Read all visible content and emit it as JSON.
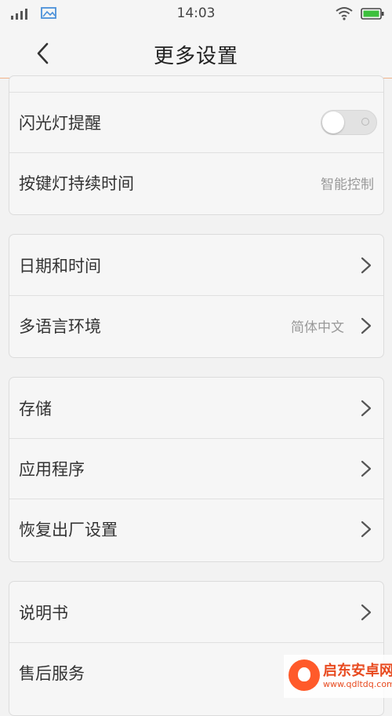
{
  "status_bar": {
    "time": "14:03",
    "icons": [
      "signal-icon",
      "gallery-icon",
      "wifi-icon",
      "battery-icon"
    ]
  },
  "header": {
    "title": "更多设置",
    "back_icon": "chevron-left-icon"
  },
  "groups": [
    {
      "items": [
        {
          "label": "闪光灯提醒",
          "control": "toggle",
          "toggle_on": false
        },
        {
          "label": "按键灯持续时间",
          "value": "智能控制"
        }
      ]
    },
    {
      "items": [
        {
          "label": "日期和时间"
        },
        {
          "label": "多语言环境",
          "value": "简体中文"
        }
      ]
    },
    {
      "items": [
        {
          "label": "存储"
        },
        {
          "label": "应用程序"
        },
        {
          "label": "恢复出厂设置"
        }
      ]
    },
    {
      "items": [
        {
          "label": "说明书"
        },
        {
          "label": "售后服务"
        }
      ]
    }
  ],
  "watermark": {
    "title": "启东安卓网",
    "url": "www.qdltdq.com"
  },
  "colors": {
    "background": "#f2f2f2",
    "header_divider": "#f0b38a",
    "watermark_brand": "#ff5a2a"
  }
}
